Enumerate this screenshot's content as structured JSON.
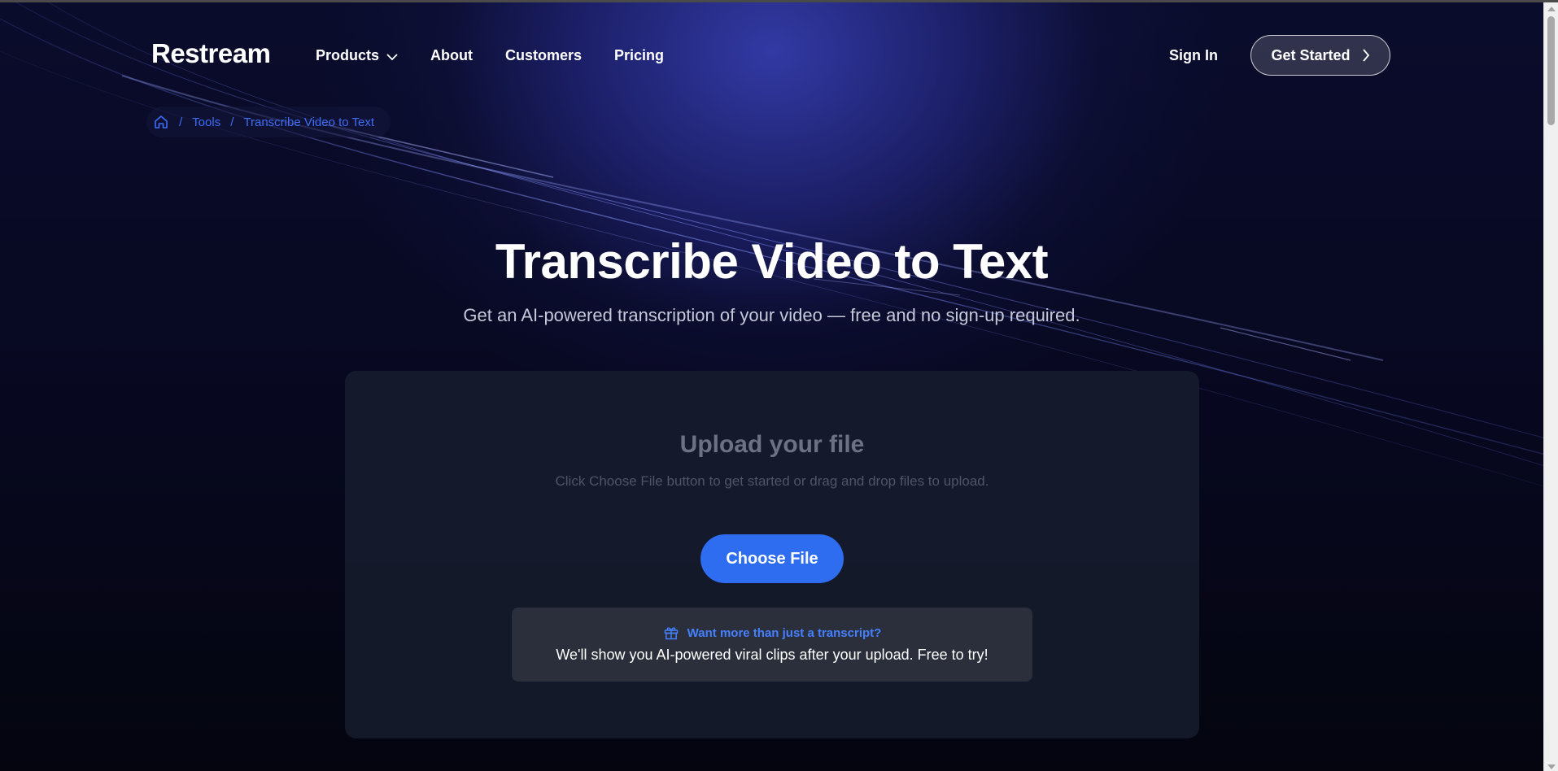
{
  "brand": {
    "logo_text": "Restream"
  },
  "nav": {
    "items": [
      {
        "label": "Products",
        "has_dropdown": true
      },
      {
        "label": "About"
      },
      {
        "label": "Customers"
      },
      {
        "label": "Pricing"
      }
    ],
    "sign_in_label": "Sign In",
    "get_started_label": "Get Started"
  },
  "breadcrumb": {
    "home_icon": "home-icon",
    "items": [
      "Tools",
      "Transcribe Video to Text"
    ],
    "separator": "/"
  },
  "hero": {
    "title": "Transcribe Video to Text",
    "subtitle": "Get an AI-powered transcription of your video — free and no sign-up required."
  },
  "upload": {
    "title": "Upload your file",
    "instructions": "Click Choose File button to get started or drag and drop files to upload.",
    "button_label": "Choose File"
  },
  "promo": {
    "icon": "gift-icon",
    "heading": "Want more than just a transcript?",
    "body": "We'll show you AI-powered viral clips after your upload. Free to try!"
  },
  "colors": {
    "accent_blue": "#2f6df0",
    "link_blue": "#3e6df5",
    "promo_blue": "#4580ff",
    "background": "#06071a"
  }
}
